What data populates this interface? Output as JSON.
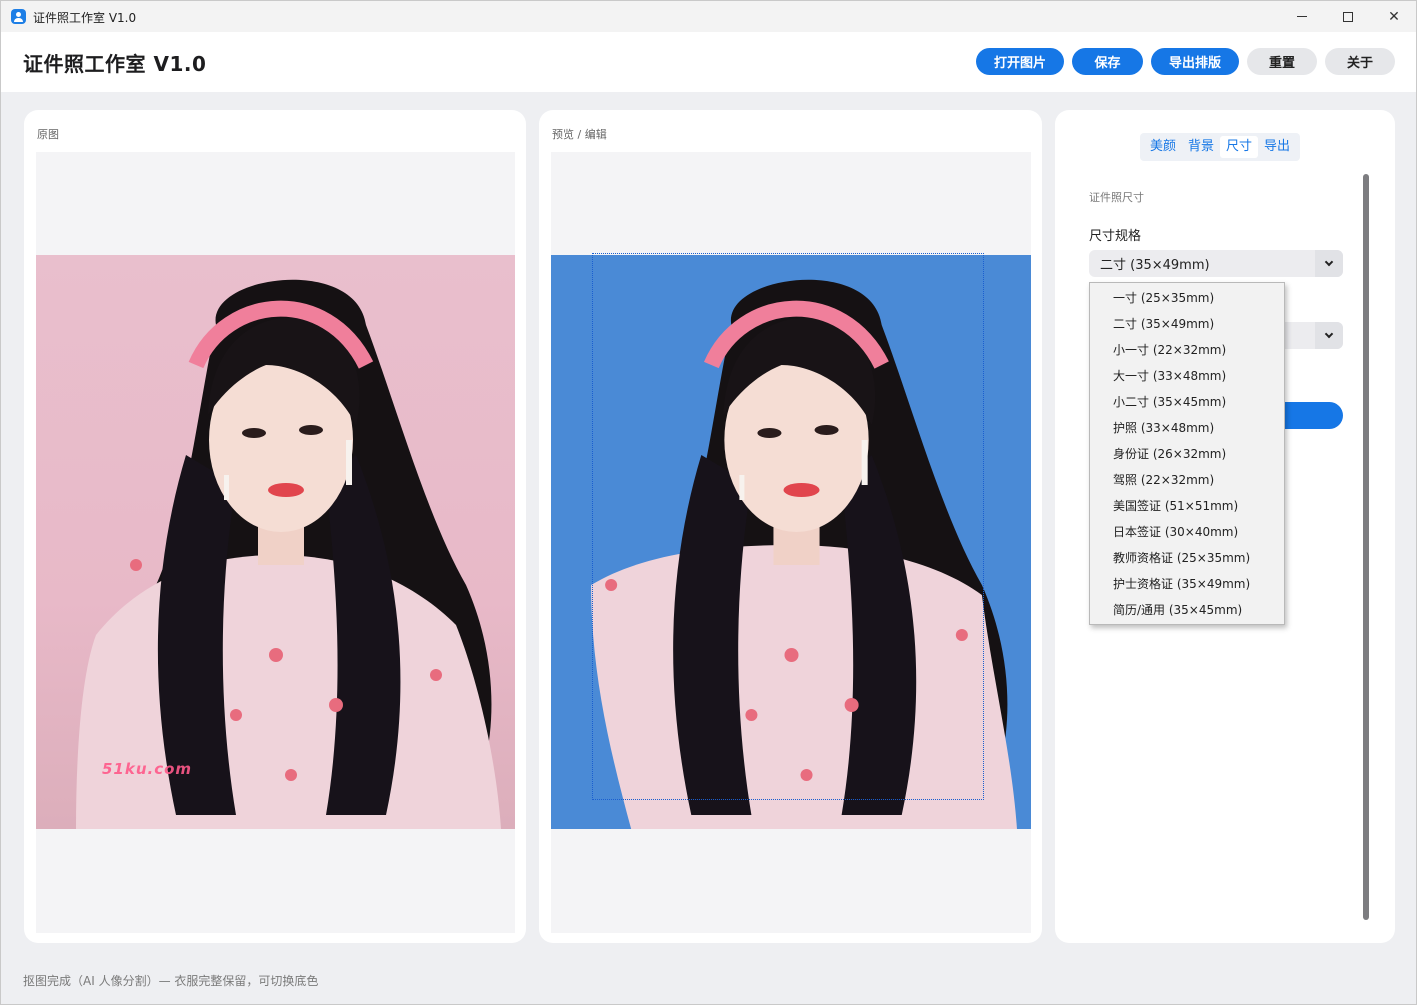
{
  "window": {
    "title": "证件照工作室 V1.0",
    "controls": {
      "minimize": "minimize",
      "maximize": "maximize",
      "close": "✕"
    }
  },
  "header": {
    "title": "证件照工作室 V1.0",
    "buttons": {
      "open": "打开图片",
      "save": "保存",
      "export_layout": "导出排版",
      "reset": "重置",
      "about": "关于"
    }
  },
  "original_panel": {
    "label": "原图",
    "watermark": "51ku.com",
    "background_color": "#e9bfcd"
  },
  "preview_panel": {
    "label": "预览 / 编辑",
    "background_color": "#4a8ad6"
  },
  "settings_panel": {
    "tabs": [
      "美颜",
      "背景",
      "尺寸",
      "导出"
    ],
    "active_tab": "尺寸",
    "section_title": "证件照尺寸",
    "size_label": "尺寸规格",
    "size_selected": "二寸 (35×49mm)",
    "size_options": [
      "一寸 (25×35mm)",
      "二寸 (35×49mm)",
      "小一寸 (22×32mm)",
      "大一寸 (33×48mm)",
      "小二寸 (35×45mm)",
      "护照 (33×48mm)",
      "身份证 (26×32mm)",
      "驾照 (22×32mm)",
      "美国签证 (51×51mm)",
      "日本签证 (30×40mm)",
      "教师资格证 (25×35mm)",
      "护士资格证 (35×49mm)",
      "简历/通用 (35×45mm)"
    ]
  },
  "status": {
    "text": "抠图完成（AI 人像分割）— 衣服完整保留，可切换底色"
  }
}
